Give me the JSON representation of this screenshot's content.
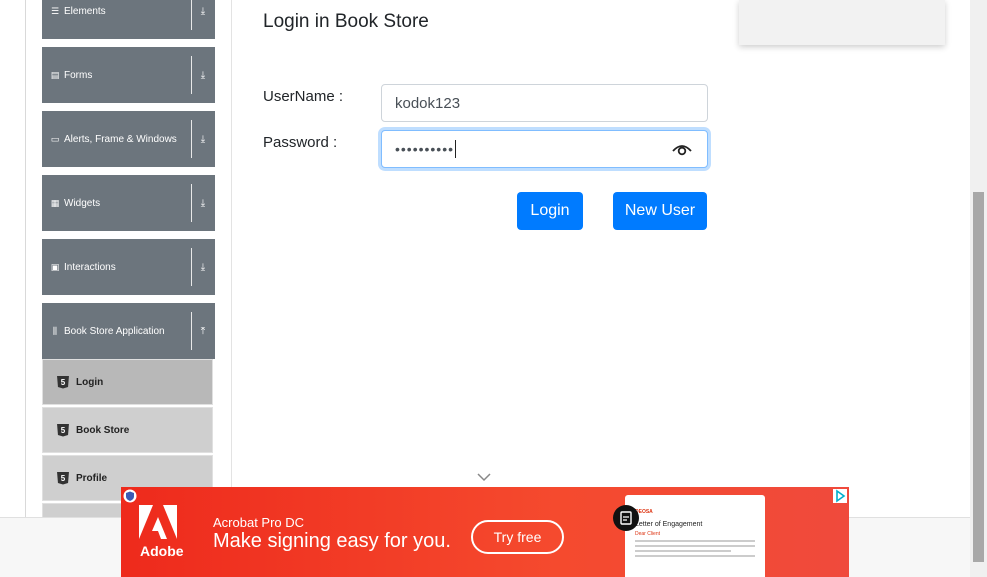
{
  "sidebar": {
    "groups": [
      {
        "label": "Elements",
        "icon": "hamburger-icon",
        "icon_glyph": "☰",
        "arrow": "⤓"
      },
      {
        "label": "Forms",
        "icon": "form-icon",
        "icon_glyph": "▤",
        "arrow": "⤓"
      },
      {
        "label": "Alerts, Frame & Windows",
        "icon": "window-icon",
        "icon_glyph": "▭",
        "arrow": "⤓"
      },
      {
        "label": "Widgets",
        "icon": "widgets-icon",
        "icon_glyph": "▦",
        "arrow": "⤓"
      },
      {
        "label": "Interactions",
        "icon": "interactions-icon",
        "icon_glyph": "▣",
        "arrow": "⤓"
      },
      {
        "label": "Book Store Application",
        "icon": "library-icon",
        "icon_glyph": "⫼",
        "arrow": "⤒"
      }
    ],
    "book_store_items": [
      {
        "label": "Login",
        "active": true
      },
      {
        "label": "Book Store",
        "active": false
      },
      {
        "label": "Profile",
        "active": false
      }
    ],
    "item_badge": "5"
  },
  "main": {
    "title": "Login in Book Store",
    "username_label": "UserName :",
    "username_value": "kodok123",
    "password_label": "Password :",
    "password_masked": "••••••••••",
    "login_button": "Login",
    "new_user_button": "New User"
  },
  "ad": {
    "brand": "Adobe",
    "product": "Acrobat Pro DC",
    "tagline": "Make signing easy for you.",
    "cta": "Try free",
    "doc_brand": "DEOSA",
    "doc_title": "Letter of Engagement",
    "doc_sub": "Dear Client"
  },
  "colors": {
    "primary": "#007bff",
    "sidebar_group": "#6c757d",
    "sidebar_item": "#cfcfcf",
    "ad_red": "#f0301f"
  }
}
